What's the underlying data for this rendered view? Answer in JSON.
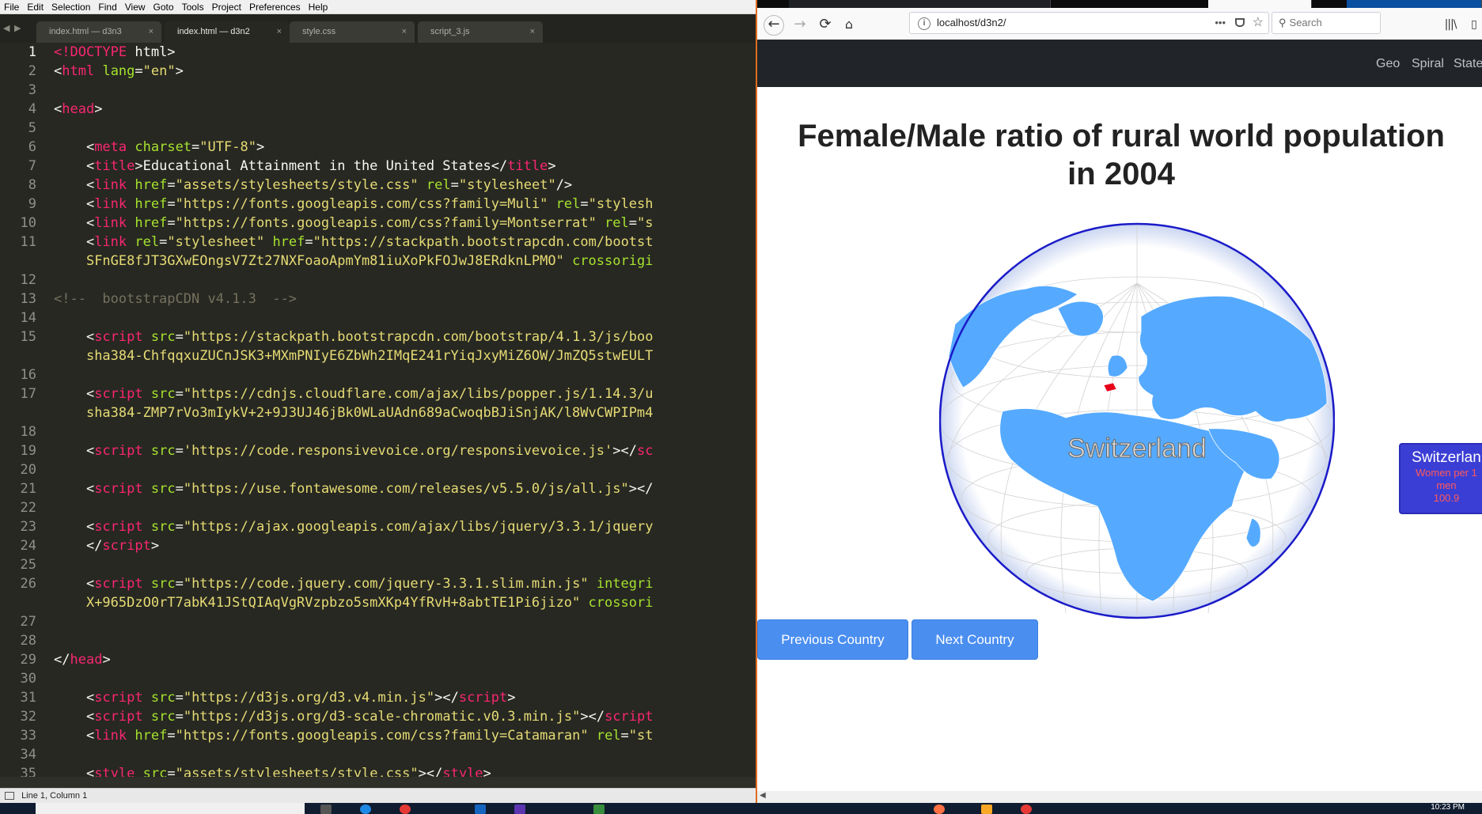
{
  "editor": {
    "menu": [
      "File",
      "Edit",
      "Selection",
      "Find",
      "View",
      "Goto",
      "Tools",
      "Project",
      "Preferences",
      "Help"
    ],
    "tabs": [
      {
        "label": "index.html — d3n3",
        "active": false
      },
      {
        "label": "index.html — d3n2",
        "active": true
      },
      {
        "label": "style.css",
        "active": false
      },
      {
        "label": "script_3.js",
        "active": false
      }
    ],
    "tab_close_glyph": "×",
    "current_line": 1,
    "lines": [
      {
        "n": "1",
        "html": "<span class=\"tg\">&lt;!DOCTYPE</span> html&gt;"
      },
      {
        "n": "2",
        "html": "&lt;<span class=\"tg\">html</span> <span class=\"at\">lang</span>=<span class=\"st\">\"en\"</span>&gt;"
      },
      {
        "n": "3",
        "html": ""
      },
      {
        "n": "4",
        "html": "&lt;<span class=\"tg\">head</span>&gt;"
      },
      {
        "n": "5",
        "html": ""
      },
      {
        "n": "6",
        "html": "    &lt;<span class=\"tg\">meta</span> <span class=\"at\">charset</span>=<span class=\"st\">\"UTF-8\"</span>&gt;"
      },
      {
        "n": "7",
        "html": "    &lt;<span class=\"tg\">title</span>&gt;Educational Attainment in the United States&lt;/<span class=\"tg\">title</span>&gt;"
      },
      {
        "n": "8",
        "html": "    &lt;<span class=\"tg\">link</span> <span class=\"at\">href</span>=<span class=\"st\">\"assets/stylesheets/style.css\"</span> <span class=\"at\">rel</span>=<span class=\"st\">\"stylesheet\"</span>/&gt;"
      },
      {
        "n": "9",
        "html": "    &lt;<span class=\"tg\">link</span> <span class=\"at\">href</span>=<span class=\"st\">\"https://fonts.googleapis.com/css?family=Muli\"</span> <span class=\"at\">rel</span>=<span class=\"st\">\"stylesh</span>"
      },
      {
        "n": "10",
        "html": "    &lt;<span class=\"tg\">link</span> <span class=\"at\">href</span>=<span class=\"st\">\"https://fonts.googleapis.com/css?family=Montserrat\"</span> <span class=\"at\">rel</span>=<span class=\"st\">\"s</span>"
      },
      {
        "n": "11",
        "html": "    &lt;<span class=\"tg\">link</span> <span class=\"at\">rel</span>=<span class=\"st\">\"stylesheet\"</span> <span class=\"at\">href</span>=<span class=\"st\">\"https://stackpath.bootstrapcdn.com/bootst</span>"
      },
      {
        "n": "",
        "html": "    <span class=\"st\">SFnGE8fJT3GXwEOngsV7Zt27NXFoaoApmYm81iuXoPkFOJwJ8ERdknLPMO\"</span> <span class=\"at\">crossorigi</span>"
      },
      {
        "n": "12",
        "html": ""
      },
      {
        "n": "13",
        "html": "<span class=\"cm\">&lt;!--  bootstrapCDN v4.1.3  --&gt;</span>"
      },
      {
        "n": "14",
        "html": ""
      },
      {
        "n": "15",
        "html": "    &lt;<span class=\"tg\">script</span> <span class=\"at\">src</span>=<span class=\"st\">\"https://stackpath.bootstrapcdn.com/bootstrap/4.1.3/js/boo</span>"
      },
      {
        "n": "",
        "html": "    <span class=\"st\">sha384-ChfqqxuZUCnJSK3+MXmPNIyE6ZbWh2IMqE241rYiqJxyMiZ6OW/JmZQ5stwEULT</span>"
      },
      {
        "n": "16",
        "html": ""
      },
      {
        "n": "17",
        "html": "    &lt;<span class=\"tg\">script</span> <span class=\"at\">src</span>=<span class=\"st\">\"https://cdnjs.cloudflare.com/ajax/libs/popper.js/1.14.3/u</span>"
      },
      {
        "n": "",
        "html": "    <span class=\"st\">sha384-ZMP7rVo3mIykV+2+9J3UJ46jBk0WLaUAdn689aCwoqbBJiSnjAK/l8WvCWPIPm4</span>"
      },
      {
        "n": "18",
        "html": ""
      },
      {
        "n": "19",
        "html": "    &lt;<span class=\"tg\">script</span> <span class=\"at\">src</span>=<span class=\"st\">'https://code.responsivevoice.org/responsivevoice.js'</span>&gt;&lt;/<span class=\"tg\">sc</span>"
      },
      {
        "n": "20",
        "html": ""
      },
      {
        "n": "21",
        "html": "    &lt;<span class=\"tg\">script</span> <span class=\"at\">src</span>=<span class=\"st\">\"https://use.fontawesome.com/releases/v5.5.0/js/all.js\"</span>&gt;&lt;/"
      },
      {
        "n": "22",
        "html": ""
      },
      {
        "n": "23",
        "html": "    &lt;<span class=\"tg\">script</span> <span class=\"at\">src</span>=<span class=\"st\">\"https://ajax.googleapis.com/ajax/libs/jquery/3.3.1/jquery</span>"
      },
      {
        "n": "24",
        "html": "    &lt;/<span class=\"tg\">script</span>&gt;"
      },
      {
        "n": "25",
        "html": ""
      },
      {
        "n": "26",
        "html": "    &lt;<span class=\"tg\">script</span> <span class=\"at\">src</span>=<span class=\"st\">\"https://code.jquery.com/jquery-3.3.1.slim.min.js\"</span> <span class=\"at\">integri</span>"
      },
      {
        "n": "",
        "html": "    <span class=\"st\">X+965DzO0rT7abK41JStQIAqVgRVzpbzo5smXKp4YfRvH+8abtTE1Pi6jizo\"</span> <span class=\"at\">crossori</span>"
      },
      {
        "n": "27",
        "html": ""
      },
      {
        "n": "28",
        "html": ""
      },
      {
        "n": "29",
        "html": "&lt;/<span class=\"tg\">head</span>&gt;"
      },
      {
        "n": "30",
        "html": ""
      },
      {
        "n": "31",
        "html": "    &lt;<span class=\"tg\">script</span> <span class=\"at\">src</span>=<span class=\"st\">\"https://d3js.org/d3.v4.min.js\"</span>&gt;&lt;/<span class=\"tg\">script</span>&gt;"
      },
      {
        "n": "32",
        "html": "    &lt;<span class=\"tg\">script</span> <span class=\"at\">src</span>=<span class=\"st\">\"https://d3js.org/d3-scale-chromatic.v0.3.min.js\"</span>&gt;&lt;/<span class=\"tg\">script</span>"
      },
      {
        "n": "33",
        "html": "    &lt;<span class=\"tg\">link</span> <span class=\"at\">href</span>=<span class=\"st\">\"https://fonts.googleapis.com/css?family=Catamaran\"</span> <span class=\"at\">rel</span>=<span class=\"st\">\"st</span>"
      },
      {
        "n": "34",
        "html": ""
      },
      {
        "n": "35",
        "html": "    &lt;<span class=\"tg\">style</span> <span class=\"at\">src</span>=<span class=\"st\">\"assets/stylesheets/style.css\"</span>&gt;&lt;/<span class=\"tg\">style</span>&gt;"
      }
    ],
    "status": "Line 1, Column 1",
    "colors": {
      "background": "#272822",
      "tag": "#f92672",
      "attribute": "#a6e22e",
      "string": "#e6db74",
      "comment": "#75715e"
    }
  },
  "browser": {
    "url": "localhost/d3n2/",
    "search_placeholder": "Search",
    "nav_links": [
      "Geo",
      "Spiral",
      "State"
    ],
    "title_line1": "Female/Male ratio of rural world population",
    "title_line2": "in 2004",
    "globe": {
      "highlighted_country": "Switzerland",
      "ocean_color": "#ffffff",
      "land_color": "#55aaff",
      "outline_color": "#1a1ac8",
      "highlight_color": "#e8001a"
    },
    "tooltip": {
      "country": "Switzerlan",
      "metric_line1": "Women per 1",
      "metric_line2": "men",
      "value": "100.9"
    },
    "buttons": {
      "previous": "Previous Country",
      "next": "Next Country"
    },
    "colors": {
      "button": "#4a8ef0",
      "navbar": "#212529",
      "tooltip": "#3b3ed4"
    }
  },
  "taskbar": {
    "clock": "10:23 PM"
  }
}
